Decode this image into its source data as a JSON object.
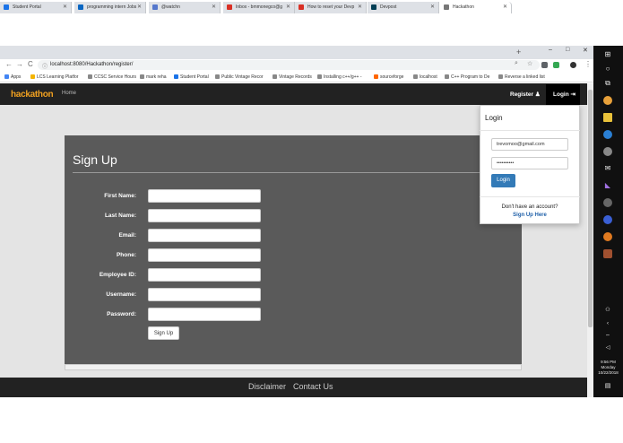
{
  "browser": {
    "tabs": [
      {
        "title": "Student Portal",
        "color": "#1a73e8"
      },
      {
        "title": "programming intern Jobs",
        "color": "#0a66c2"
      },
      {
        "title": "@watchn",
        "color": "#5577cc"
      },
      {
        "title": "Inbox - bmmonegco@g",
        "color": "#d93025"
      },
      {
        "title": "How to reset your Devp",
        "color": "#d93025"
      },
      {
        "title": "Devpost",
        "color": "#003e54"
      },
      {
        "title": "Hackathon",
        "color": "#777777"
      }
    ],
    "new_tab": "+",
    "window_controls": {
      "minimize": "–",
      "maximize": "□",
      "close": "✕"
    },
    "url": "localhost:8080/Hackathon/register/",
    "nav": {
      "back": "←",
      "forward": "→",
      "reload": "C"
    },
    "bookmarks": [
      {
        "label": "Apps",
        "color": "#4285f4"
      },
      {
        "label": "LCS Learning Platfor",
        "color": "#f4b400"
      },
      {
        "label": "CCSC Service Hours",
        "color": "#888888"
      },
      {
        "label": "mark reha",
        "color": "#888888"
      },
      {
        "label": "Student Portal",
        "color": "#1a73e8"
      },
      {
        "label": "Public Vintage Recor",
        "color": "#888888"
      },
      {
        "label": "Vintage Records",
        "color": "#888888"
      },
      {
        "label": "Installing c++/g++ -",
        "color": "#888888"
      },
      {
        "label": "sourceforge",
        "color": "#ff6600"
      },
      {
        "label": "localhost",
        "color": "#888888"
      },
      {
        "label": "C++ Program to De",
        "color": "#888888"
      },
      {
        "label": "Reverse a linked list",
        "color": "#888888"
      }
    ]
  },
  "navbar": {
    "logo_main": "hack",
    "logo_accent": "athon",
    "home": "Home",
    "register": "Register",
    "login": "Login"
  },
  "signup": {
    "title": "Sign Up",
    "fields": [
      {
        "label": "First Name:"
      },
      {
        "label": "Last Name:"
      },
      {
        "label": "Email:"
      },
      {
        "label": "Phone:"
      },
      {
        "label": "Employee ID:"
      },
      {
        "label": "Username:"
      },
      {
        "label": "Password:"
      }
    ],
    "button": "Sign Up"
  },
  "login_dropdown": {
    "title": "Login",
    "email_value": "trevomoo@gmail.com",
    "password_value": "••••••••••",
    "button": "Login",
    "no_account": "Don't have an account?",
    "signup_link": "Sign Up Here"
  },
  "footer": {
    "disclaimer": "Disclaimer",
    "contact": "Contact Us"
  },
  "taskbar": {
    "time": "9:56 PM",
    "day": "Monday",
    "date": "10/22/2018"
  }
}
